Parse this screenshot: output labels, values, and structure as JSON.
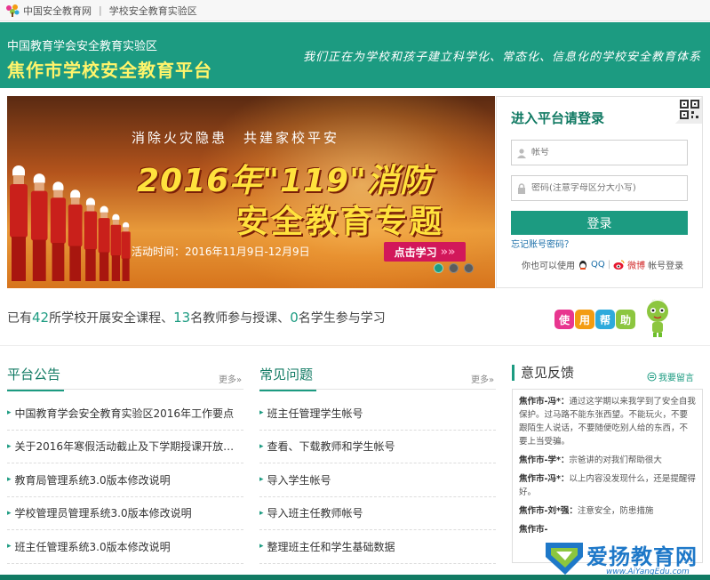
{
  "topbar": {
    "site_name": "中国安全教育网",
    "separator": "|",
    "lab_link": "学校安全教育实验区"
  },
  "header": {
    "subtitle": "中国教育学会安全教育实验区",
    "title": "焦作市学校安全教育平台",
    "slogan": "我们正在为学校和孩子建立科学化、常态化、信息化的学校安全教育体系"
  },
  "banner": {
    "slogan": "消除火灾隐患　共建家校平安",
    "headline_1": "2016年\"119\"消防",
    "headline_2": "安全教育专题",
    "time": "活动时间：2016年11月9日-12月9日",
    "learn_label": "点击学习",
    "slide_count": 3,
    "active_slide": 1
  },
  "login": {
    "heading": "进入平台请登录",
    "username_placeholder": "帐号",
    "password_placeholder": "密码(注意字母区分大小写)",
    "submit_label": "登录",
    "forgot_label": "忘记账号密码？",
    "oauth_prefix": "你也可以使用",
    "qq_label": "QQ",
    "weibo_label": "微博",
    "oauth_suffix": "帐号登录"
  },
  "stats": {
    "prefix": "已有",
    "schools": "42",
    "schools_text": "所学校开展安全课程、",
    "teachers": "13",
    "teachers_text": "名教师参与授课、",
    "students": "0",
    "students_text": "名学生参与学习"
  },
  "help_badge": {
    "letters": [
      "使",
      "用",
      "帮",
      "助"
    ],
    "colors": [
      "#e8368f",
      "#f39c12",
      "#2eaadc",
      "#8cc63f"
    ]
  },
  "announcements": {
    "title": "平台公告",
    "more": "更多",
    "items": [
      "中国教育学会安全教育实验区2016年工作要点",
      "关于2016年寒假活动截止及下学期授课开放…",
      "教育局管理系统3.0版本修改说明",
      "学校管理员管理系统3.0版本修改说明",
      "班主任管理系统3.0版本修改说明"
    ]
  },
  "faq": {
    "title": "常见问题",
    "more": "更多",
    "items": [
      "班主任管理学生帐号",
      "查看、下载教师和学生帐号",
      "导入学生帐号",
      "导入班主任教师帐号",
      "整理班主任和学生基础数据"
    ]
  },
  "feedback": {
    "title": "意见反馈",
    "message_label": "我要留言",
    "items": [
      {
        "who": "焦作市-冯*：",
        "text": "通过这学期以来我学到了安全自我保护。过马路不能东张西望。不能玩火，不要跟陌生人说话，不要随便吃别人给的东西，不要上当受骗。"
      },
      {
        "who": "焦作市-学*：",
        "text": "宗爸讲的对我们帮助很大"
      },
      {
        "who": "焦作市-冯*：",
        "text": "以上内容没发现什么，还是提醒得好。"
      },
      {
        "who": "焦作市-刘*强：",
        "text": "注意安全，防患措施"
      },
      {
        "who": "焦作市-",
        "text": ""
      }
    ]
  },
  "watermark": {
    "text": "爱扬教育网",
    "url": "www.AiYangEdu.com"
  }
}
